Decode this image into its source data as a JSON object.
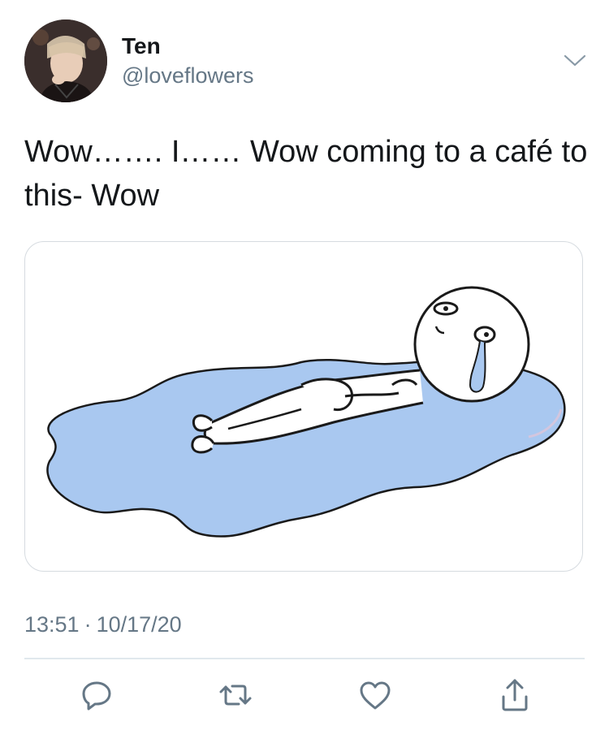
{
  "tweet": {
    "author": {
      "display_name": "Ten",
      "handle": "@loveflowers"
    },
    "text": "Wow……. I…… Wow coming to a café to this- Wow",
    "media": {
      "description_icon": "crying-puddle-illustration",
      "puddle_color": "#a9c8f0"
    },
    "time": "13:51",
    "separator": "·",
    "date": "10/17/20"
  },
  "actions": [
    {
      "icon": "reply-icon"
    },
    {
      "icon": "retweet-icon"
    },
    {
      "icon": "like-icon"
    },
    {
      "icon": "share-icon"
    }
  ],
  "colors": {
    "text_primary": "#14171a",
    "text_secondary": "#657786",
    "icon": "#657786",
    "border": "#d6dbe0"
  }
}
